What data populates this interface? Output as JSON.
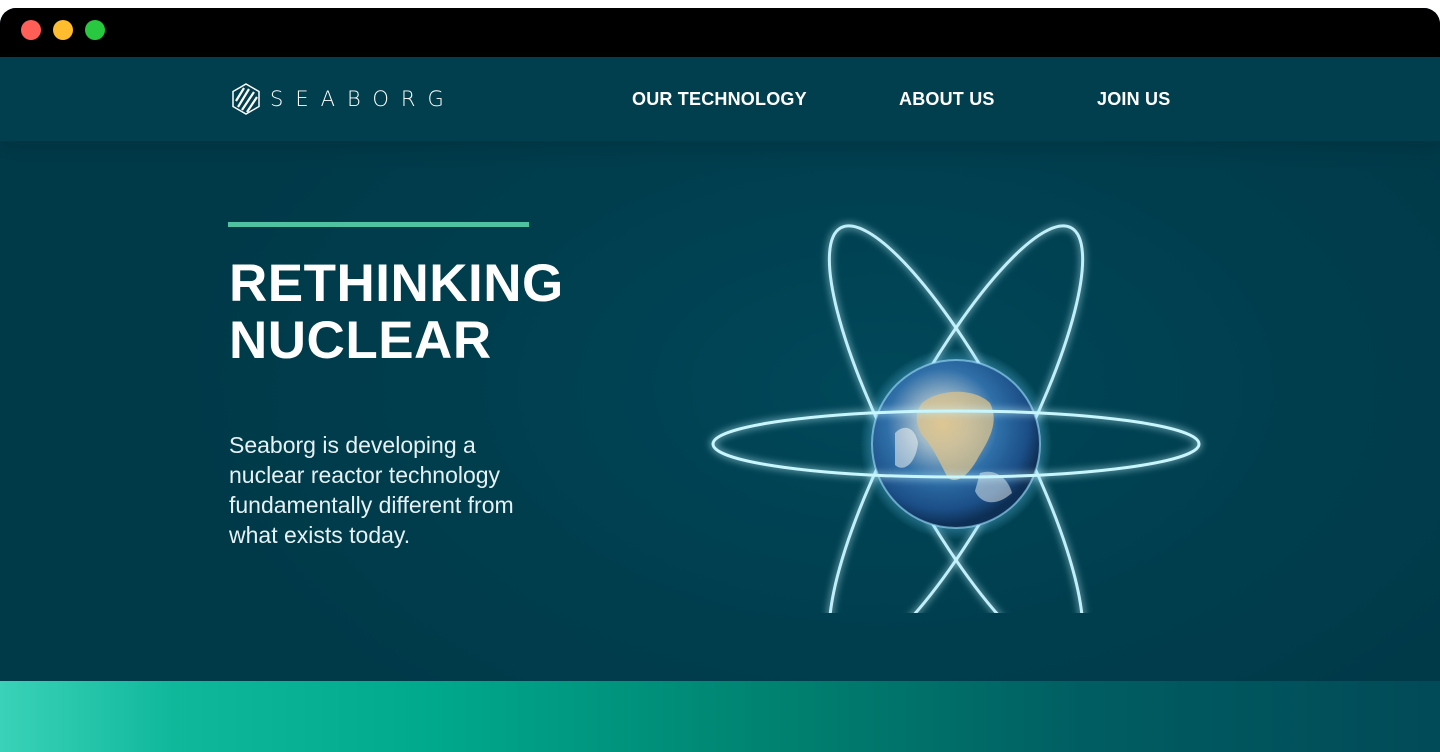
{
  "brand": {
    "name": "SEABORG",
    "logo_icon": "seaborg-hexagon-logo"
  },
  "nav": {
    "items": [
      {
        "label": "OUR TECHNOLOGY"
      },
      {
        "label": "ABOUT US"
      },
      {
        "label": "JOIN US"
      }
    ]
  },
  "hero": {
    "title_line1": "RETHINKING",
    "title_line2": "NUCLEAR",
    "body_lines": [
      "Seaborg is developing a",
      "nuclear reactor technology",
      "fundamentally different from",
      "what exists today."
    ],
    "illustration": "atom-with-earth-nucleus"
  },
  "colors": {
    "background": "#003f4f",
    "accent": "#4fc3a1",
    "text": "#ffffff",
    "glow": "#b9f2ff"
  }
}
